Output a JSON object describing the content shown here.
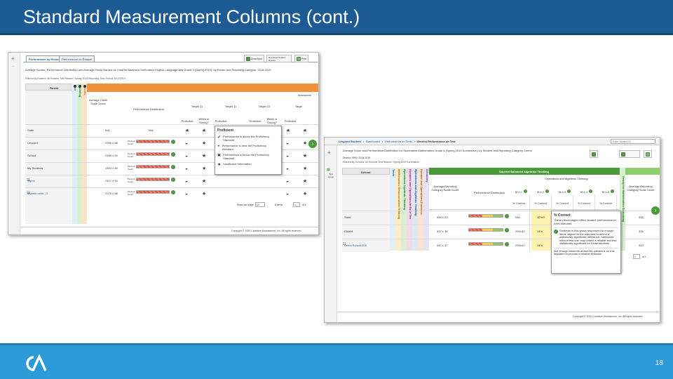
{
  "slide": {
    "title": "Standard Measurement Columns (cont.)",
    "page_number": "18",
    "colors": {
      "title_bar": "#1c5b94",
      "footer_bar": "#2b9ad6",
      "accent_orange": "#f0923a",
      "accent_green": "#4a9a3a"
    },
    "logo": "CA"
  },
  "shot1": {
    "tabs": [
      "Performance by Roster",
      "Performance on Dataset"
    ],
    "toolbar": [
      "Download",
      "Download Student Results",
      "Print"
    ],
    "description": "Average Scores, Performance Distribution and Average Points Earned on Smarter Balanced Summative English Language Arts Grade 3 (Spring 2019), by Roster and Reporting Category: 2018-2019",
    "filters": "Filtered by Rosters: All Rosters   Test Reason: Spring 2019   Reporting Time Period: 8/12/2019",
    "group_header": "Roster",
    "band_header": "Assessment",
    "vertical_columns": [
      "Test",
      "Updating",
      "Results"
    ],
    "headers": {
      "avg": "Average Claim Scale Score",
      "dist": "Performance Distribution",
      "targets": [
        "Target 11",
        "Target 11",
        "Target 12",
        "Targe"
      ],
      "sub": [
        "Proficient",
        "Week or Strong?"
      ]
    },
    "rows": [
      {
        "name": "State",
        "score": "N/A",
        "dist": "N/A"
      },
      {
        "name": "Leopard",
        "score": "2395 ± 58",
        "dist": "Percent Count"
      },
      {
        "name": "School",
        "score": "2396 ± 59",
        "dist": "Percent Count"
      },
      {
        "name": "My Students",
        "score": "2393 ± 59",
        "dist": "Percent Count"
      },
      {
        "name": "Tigers",
        "score": "2417 ± 53",
        "dist": "Percent Count"
      },
      {
        "name": "shared roster - 2",
        "score": "2379 ± 58",
        "dist": "Percent Count"
      }
    ],
    "tooltip": {
      "title": "Proficient",
      "items": [
        "Performance is above the Proficiency Standard",
        "Performance is near the Proficiency Standard",
        "Performance is below the Proficiency Standard",
        "Insufficient Information"
      ]
    },
    "pager": {
      "label": "Rows per page",
      "value": "10",
      "results": "5 items",
      "page": "1",
      "of": "of 1"
    },
    "copyright": "Copyright © 2020 Cambium Assessment, Inc. All rights reserved."
  },
  "shot2": {
    "breadcrumb": [
      "Leopard Student",
      "Dashboard",
      "Performance on Tests",
      "District Performance on Test"
    ],
    "search_placeholder": "Enter Student ID",
    "description": "Average Score and Performance Distribution for Summative Mathematics Grade 6 (Spring 2019 Summative), by Student and Reporting Category: Demo",
    "subdesc": "District: 9999, 2018-2019",
    "filters": "Filtered By Schools: All Schools   Test Reason: Spring 2019 Summative",
    "side_label": "Test Group",
    "group_header": "School",
    "band_header": "Smarter Balanced Algebraic Thinking",
    "sub_band": "Operations and Algebraic Thinking",
    "vertical_columns": [
      "Tests",
      "Mathematics Demonstration Thinking",
      "Operations Algebraic Thinking",
      "Numbers and Operations in Base Ten",
      "Operations and Algebraic Thinking",
      "Number and Operations-Fractions",
      "Geometry"
    ],
    "vertical_right": "Ready for Mathematics Reasoning",
    "headers": {
      "avg": "Average Reporting Category Scale Score",
      "dist": "Performance Distribution",
      "cols": [
        "M.4.1",
        "M.4.2",
        "M.4.3",
        "M.4.4",
        "M.4.5"
      ],
      "sub": [
        "% Correct",
        "% Correct",
        "% Correct",
        "% Correct",
        "% Correct"
      ],
      "avg_right": "Average Reporting Category Scale Score"
    },
    "rows": [
      {
        "name": "State",
        "score": "368 ± 29",
        "pct1": "N/A",
        "pct2": "32%/0",
        "right": "335"
      },
      {
        "name": "District",
        "score": "347 ± 35",
        "pct1": "29%/42",
        "pct2": "34%",
        "right": "335"
      },
      {
        "name": "Demo School 009",
        "score": "347 ± 37",
        "pct1": "29%/42",
        "pct2": "34%",
        "right": "333"
      }
    ],
    "tooltip": {
      "title": "% Correct",
      "lines": [
        "These percentages reflect student performance on each standard",
        "Students in this group responded to enough items aligned to the standard to detect a statistically significant difference. Standards without this icon may reflect a reliable but less statistically significant for these students",
        "Not enough students answered questions on this standard to provide a reliable estimate"
      ]
    },
    "pager": {
      "value": "1",
      "of": "of 1"
    },
    "copyright": "Copyright © 2020 Cambium Assessment, Inc. All rights reserved."
  }
}
